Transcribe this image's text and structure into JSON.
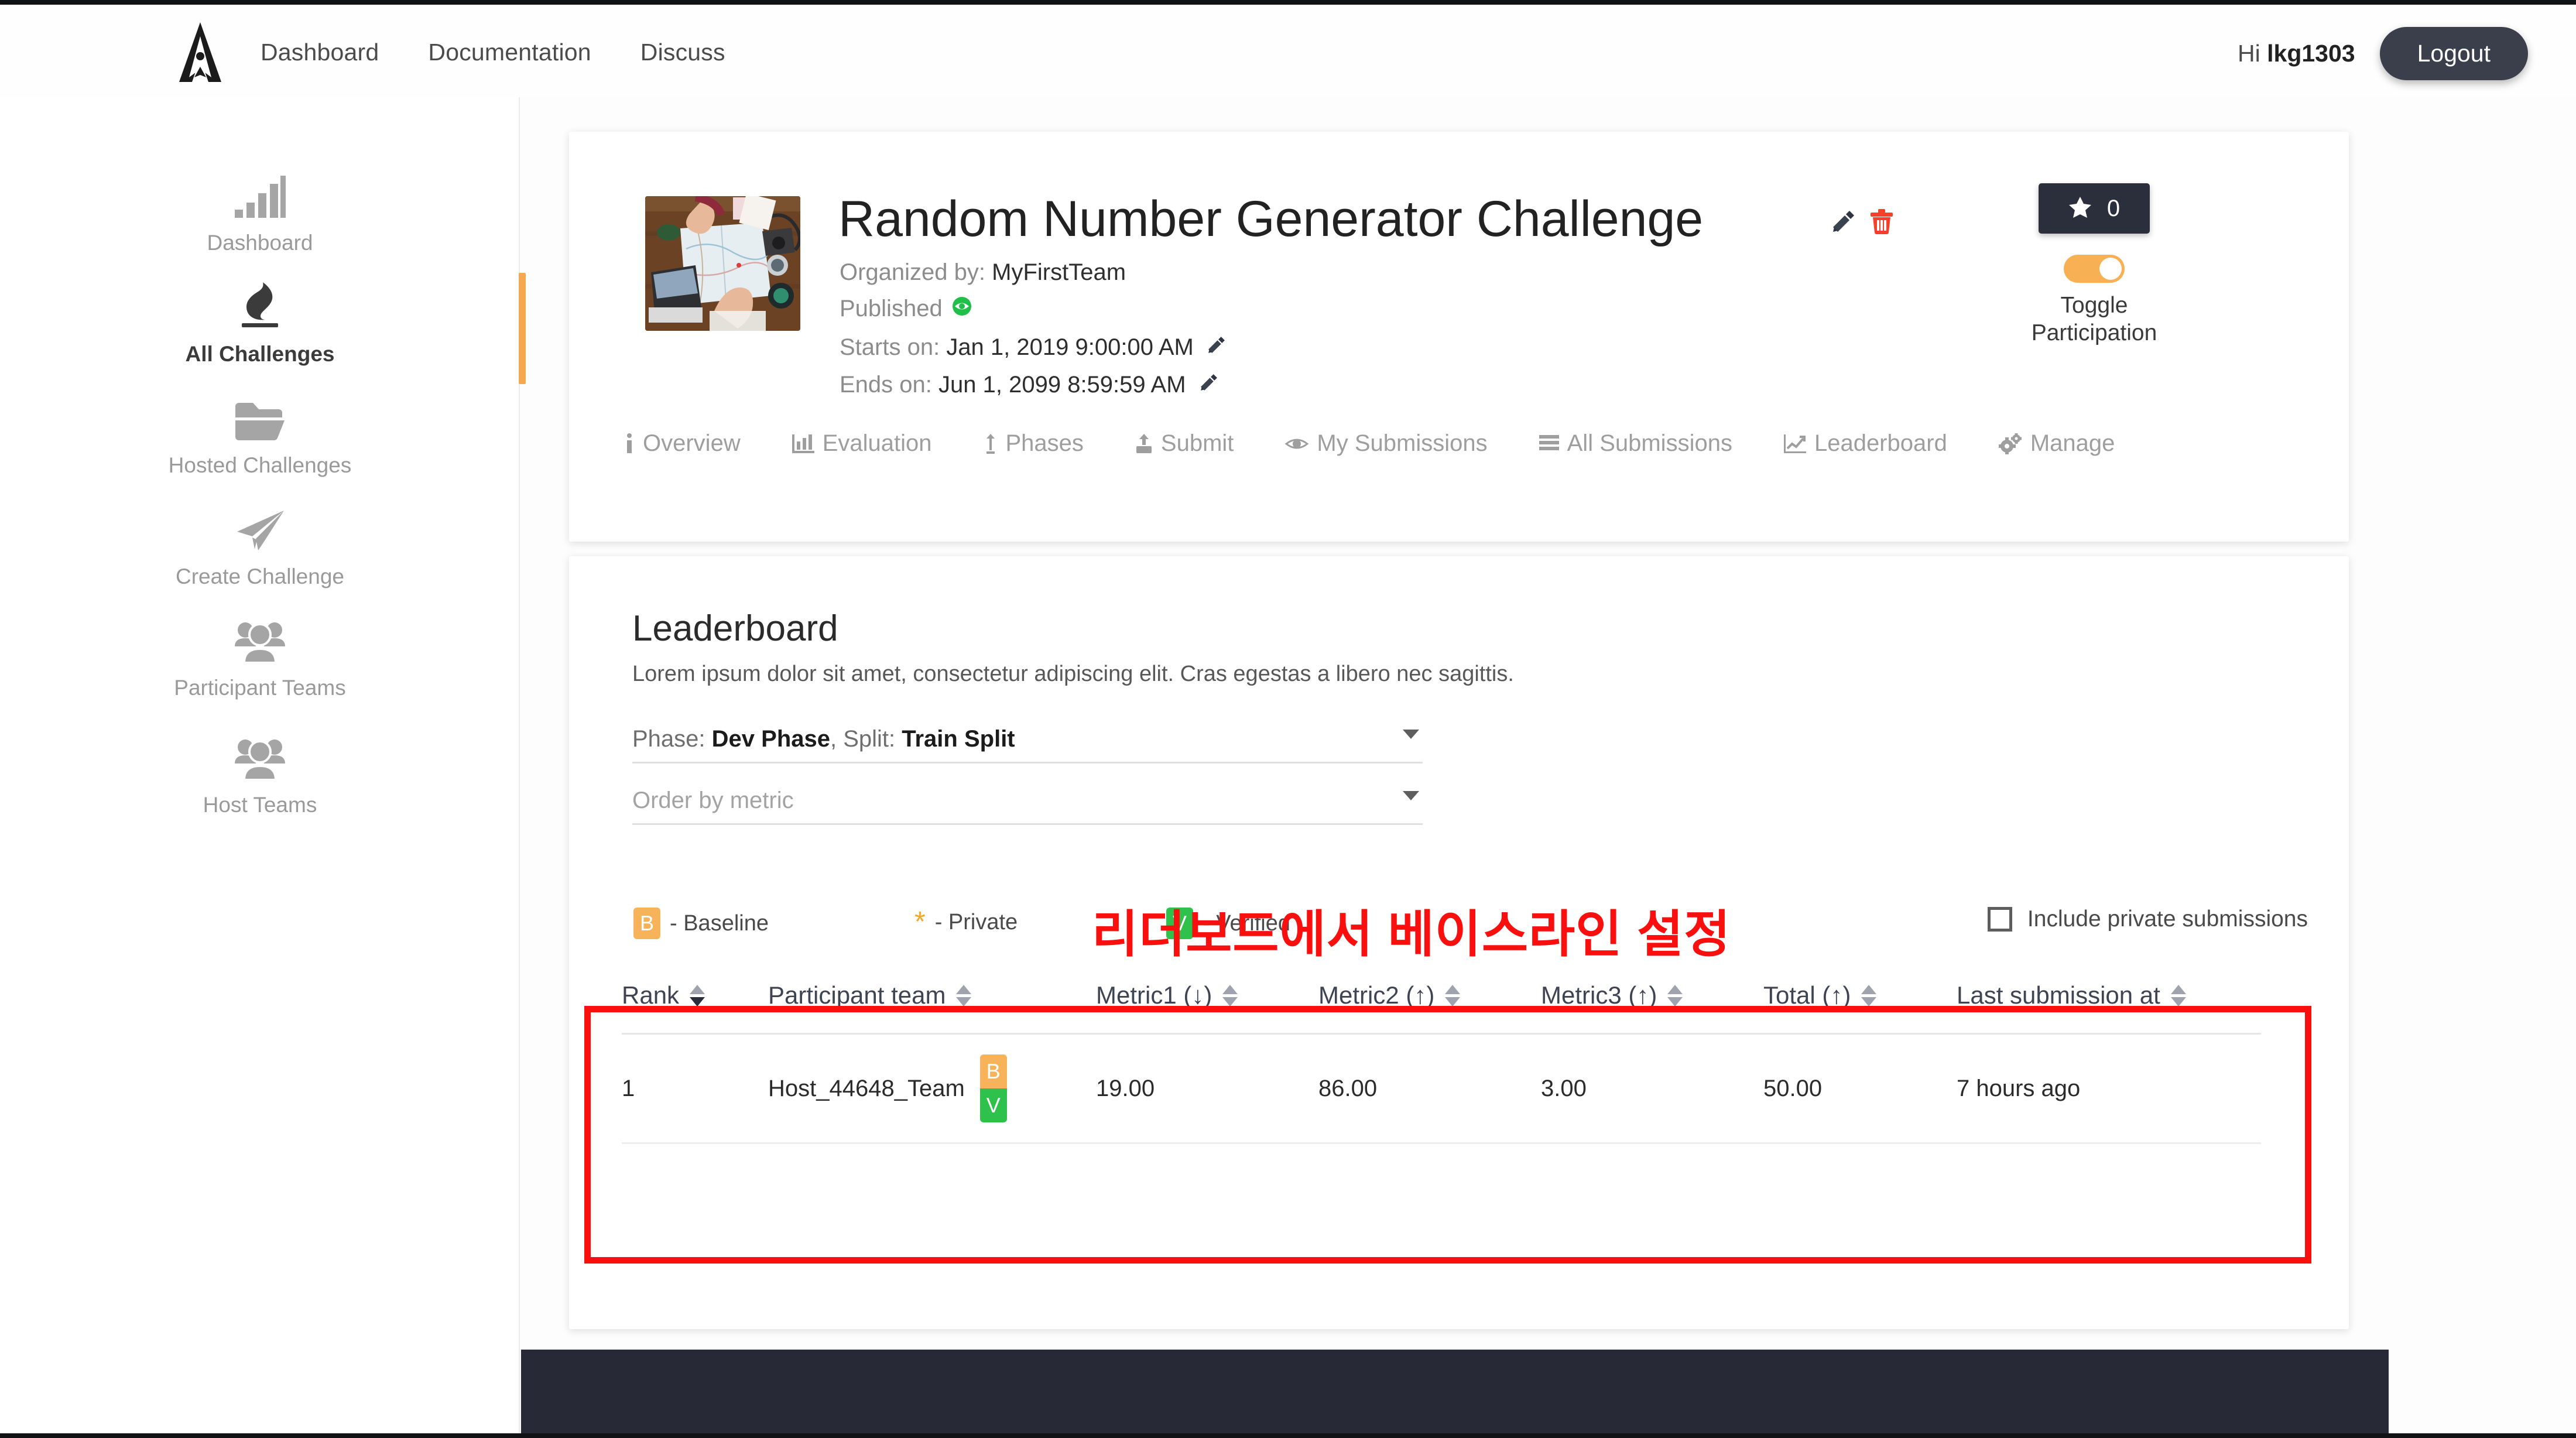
{
  "navbar": {
    "logo_icon": "rocket-logo-icon",
    "links": [
      {
        "label": "Dashboard"
      },
      {
        "label": "Documentation"
      },
      {
        "label": "Discuss"
      }
    ],
    "greeting_prefix": "Hi ",
    "username": "lkg1303",
    "logout_label": "Logout"
  },
  "sidebar": {
    "items": [
      {
        "label": "Dashboard",
        "icon": "bar-chart-icon",
        "active": false
      },
      {
        "label": "All Challenges",
        "icon": "flame-icon",
        "active": true
      },
      {
        "label": "Hosted Challenges",
        "icon": "folder-icon",
        "active": false
      },
      {
        "label": "Create Challenge",
        "icon": "paper-plane-icon",
        "active": false
      },
      {
        "label": "Participant Teams",
        "icon": "users-icon",
        "active": false
      },
      {
        "label": "Host Teams",
        "icon": "users-icon",
        "active": false
      }
    ]
  },
  "challenge": {
    "title": "Random Number Generator Challenge",
    "edit_icon": "pencil-icon",
    "delete_icon": "trash-icon",
    "organized_by_label": "Organized by: ",
    "organized_by": "MyFirstTeam",
    "published_label": "Published",
    "published_icon": "eye-green-icon",
    "starts_label": "Starts on: ",
    "starts_value": "Jan 1, 2019 9:00:00 AM",
    "ends_label": "Ends on: ",
    "ends_value": "Jun 1, 2099 8:59:59 AM",
    "star_icon": "star-icon",
    "star_count": "0",
    "toggle_state": "on",
    "toggle_label_line1": "Toggle",
    "toggle_label_line2": "Participation",
    "tabs": [
      {
        "label": "Overview",
        "icon": "info-icon",
        "active": false
      },
      {
        "label": "Evaluation",
        "icon": "bar-chart-icon",
        "active": false
      },
      {
        "label": "Phases",
        "icon": "phases-icon",
        "active": false
      },
      {
        "label": "Submit",
        "icon": "upload-icon",
        "active": false
      },
      {
        "label": "My Submissions",
        "icon": "eye-icon",
        "active": false
      },
      {
        "label": "All Submissions",
        "icon": "list-icon",
        "active": false
      },
      {
        "label": "Leaderboard",
        "icon": "line-chart-icon",
        "active": false
      },
      {
        "label": "Manage",
        "icon": "cogs-icon",
        "active": false
      }
    ]
  },
  "leaderboard": {
    "heading": "Leaderboard",
    "description": "Lorem ipsum dolor sit amet, consectetur adipiscing elit. Cras egestas a libero nec sagittis.",
    "phase_select": {
      "phase_label": "Phase: ",
      "phase_value": "Dev Phase",
      "split_label": ", Split: ",
      "split_value": "Train Split"
    },
    "metric_select": {
      "placeholder": "Order by metric"
    },
    "legend": [
      {
        "badge": "B",
        "text": "- Baseline",
        "color": "#f7b35a"
      },
      {
        "badge": "*",
        "text": "- Private",
        "color": "#f5a623"
      },
      {
        "badge": "V",
        "text": "- Verified",
        "color": "#2ec14b"
      }
    ],
    "include_private_label": "Include private submissions",
    "include_private_checked": false,
    "columns": [
      {
        "label": "Rank",
        "sorted": true
      },
      {
        "label": "Participant team",
        "sorted": false
      },
      {
        "label": "Metric1 (↓)",
        "sorted": false
      },
      {
        "label": "Metric2 (↑)",
        "sorted": false
      },
      {
        "label": "Metric3 (↑)",
        "sorted": false
      },
      {
        "label": "Total (↑)",
        "sorted": false
      },
      {
        "label": "Last submission at",
        "sorted": false
      }
    ],
    "rows": [
      {
        "rank": "1",
        "team": "Host_44648_Team",
        "badges": [
          "B",
          "V"
        ],
        "metric1": "19.00",
        "metric2": "86.00",
        "metric3": "3.00",
        "total": "50.00",
        "last_submission": "7 hours ago"
      }
    ]
  },
  "annotation": {
    "text": "리더보드에서 베이스라인 설정",
    "color": "#fa0f0f"
  },
  "colors": {
    "accent_orange": "#f5a94e",
    "dark": "#2b2e3b",
    "green": "#2ec14b",
    "red": "#fa0f0f"
  }
}
